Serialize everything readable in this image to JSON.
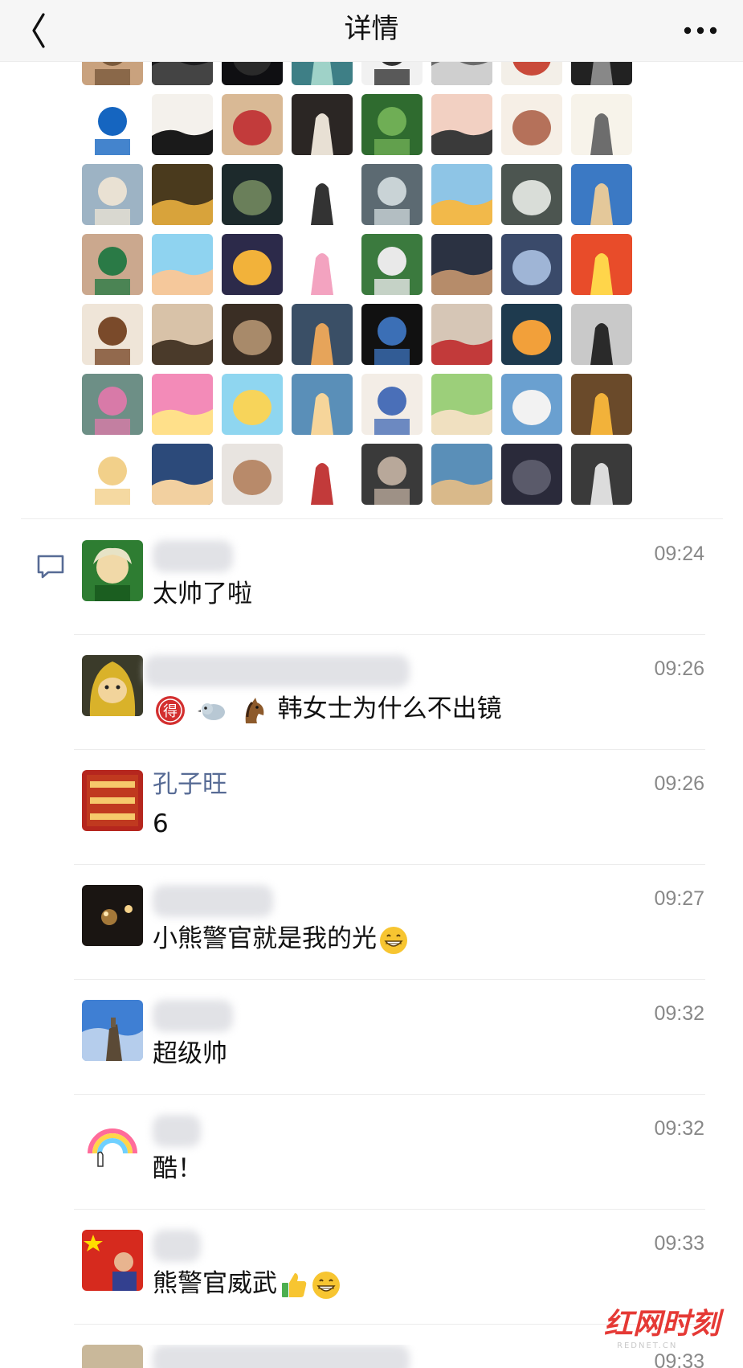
{
  "header": {
    "title": "详情",
    "back_icon": "chevron-left-icon",
    "more_icon": "more-dots-icon"
  },
  "liked_avatars_count": 56,
  "comment_icon": "comment-bubble-icon",
  "colors": {
    "name_link": "#576b95",
    "timestamp": "#888888",
    "watermark_red": "#e53935"
  },
  "comments": [
    {
      "name": "",
      "time": "09:24",
      "text": "太帅了啦"
    },
    {
      "name": "",
      "time": "09:26",
      "text": "韩女士为什么不出镜",
      "emojis": [
        "得",
        "bird-emoji",
        "horse-emoji"
      ]
    },
    {
      "name": "孔子旺",
      "time": "09:26",
      "text": "6"
    },
    {
      "name": "",
      "time": "09:27",
      "text": "小熊警官就是我的光",
      "emojis_after": [
        "grin-emoji"
      ]
    },
    {
      "name": "",
      "time": "09:32",
      "text": "超级帅"
    },
    {
      "name": "",
      "time": "09:32",
      "text": "酷！"
    },
    {
      "name": "",
      "time": "09:33",
      "text": "熊警官威武",
      "emojis_after": [
        "thumbs-up-emoji",
        "grin-emoji"
      ]
    },
    {
      "name": "",
      "time": "09:33",
      "text": ""
    }
  ],
  "watermark": {
    "brand": "红网时刻",
    "domain": "REDNET.CN"
  }
}
